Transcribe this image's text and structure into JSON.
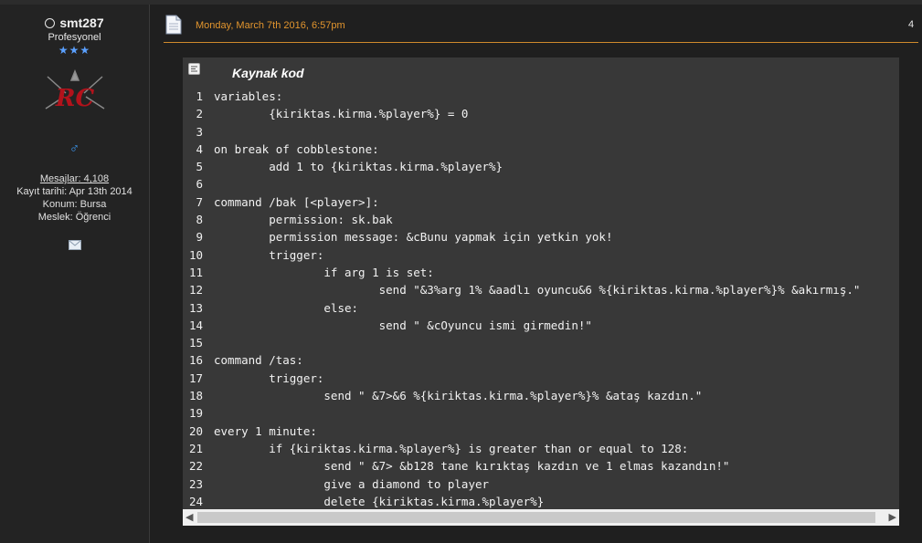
{
  "user": {
    "name": "smt287",
    "rank": "Profesyonel",
    "stars": "★★★",
    "avatar_text": "RC",
    "gender_symbol": "♂",
    "stats": {
      "messages": "Mesajlar: 4,108",
      "joined": "Kayıt tarihi: Apr 13th 2014",
      "location": "Konum: Bursa",
      "occupation": "Meslek: Öğrenci"
    }
  },
  "post": {
    "date": "Monday, March 7th 2016, 6:57pm",
    "number": "4"
  },
  "code": {
    "title": "Kaynak kod",
    "lines": [
      {
        "n": "1",
        "t": "variables:"
      },
      {
        "n": "2",
        "t": "        {kiriktas.kirma.%player%} = 0"
      },
      {
        "n": "3",
        "t": ""
      },
      {
        "n": "4",
        "t": "on break of cobblestone:"
      },
      {
        "n": "5",
        "t": "        add 1 to {kiriktas.kirma.%player%}"
      },
      {
        "n": "6",
        "t": ""
      },
      {
        "n": "7",
        "t": "command /bak [<player>]:"
      },
      {
        "n": "8",
        "t": "        permission: sk.bak"
      },
      {
        "n": "9",
        "t": "        permission message: &cBunu yapmak için yetkin yok!"
      },
      {
        "n": "10",
        "t": "        trigger:"
      },
      {
        "n": "11",
        "t": "                if arg 1 is set:"
      },
      {
        "n": "12",
        "t": "                        send \"&3%arg 1% &aadlı oyuncu&6 %{kiriktas.kirma.%player%}% &akırmış.\""
      },
      {
        "n": "13",
        "t": "                else:"
      },
      {
        "n": "14",
        "t": "                        send \" &cOyuncu ismi girmedin!\""
      },
      {
        "n": "15",
        "t": ""
      },
      {
        "n": "16",
        "t": "command /tas:"
      },
      {
        "n": "17",
        "t": "        trigger:"
      },
      {
        "n": "18",
        "t": "                send \" &7>&6 %{kiriktas.kirma.%player%}% &ataş kazdın.\""
      },
      {
        "n": "19",
        "t": ""
      },
      {
        "n": "20",
        "t": "every 1 minute:"
      },
      {
        "n": "21",
        "t": "        if {kiriktas.kirma.%player%} is greater than or equal to 128:"
      },
      {
        "n": "22",
        "t": "                send \" &7> &b128 tane kırıktaş kazdın ve 1 elmas kazandın!\""
      },
      {
        "n": "23",
        "t": "                give a diamond to player"
      },
      {
        "n": "24",
        "t": "                delete {kiriktas.kirma.%player%}"
      }
    ]
  },
  "colors": {
    "accent": "#e2952e",
    "star": "#5aa0ff",
    "code_bg": "#383838"
  }
}
